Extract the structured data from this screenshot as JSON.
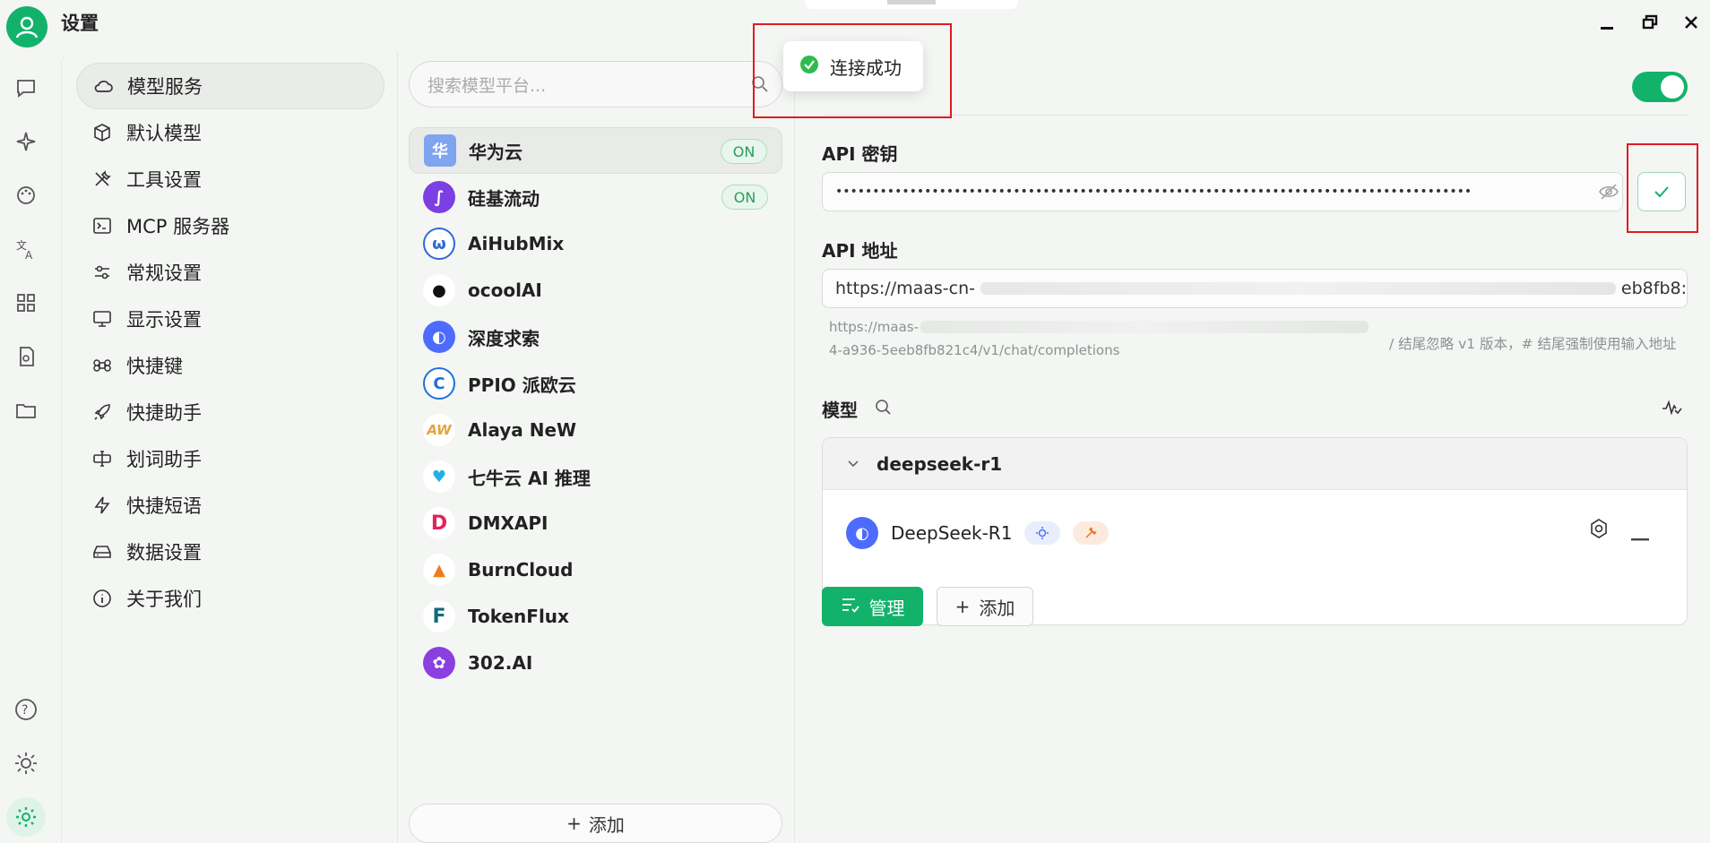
{
  "window": {
    "title": "设置"
  },
  "sidebar_nav": [
    {
      "label": "模型服务",
      "icon": "cloud-icon",
      "active": true
    },
    {
      "label": "默认模型",
      "icon": "cube-icon"
    },
    {
      "label": "工具设置",
      "icon": "tools-icon"
    },
    {
      "label": "MCP 服务器",
      "icon": "terminal-icon"
    },
    {
      "label": "常规设置",
      "icon": "sliders-icon"
    },
    {
      "label": "显示设置",
      "icon": "monitor-icon"
    },
    {
      "label": "快捷键",
      "icon": "command-icon"
    },
    {
      "label": "快捷助手",
      "icon": "rocket-icon"
    },
    {
      "label": "划词助手",
      "icon": "text-cursor-icon"
    },
    {
      "label": "快捷短语",
      "icon": "lightning-icon"
    },
    {
      "label": "数据设置",
      "icon": "drive-icon"
    },
    {
      "label": "关于我们",
      "icon": "info-icon"
    }
  ],
  "providers": {
    "search_placeholder": "搜索模型平台...",
    "items": [
      {
        "name": "华为云",
        "on": "ON",
        "active": true,
        "logo_text": "华",
        "color": "#5b8def"
      },
      {
        "name": "硅基流动",
        "on": "ON",
        "logo_text": "∫",
        "color": "#7b3fe4"
      },
      {
        "name": "AiHubMix",
        "logo_text": "ω",
        "color": "#2d6ad8"
      },
      {
        "name": "ocoolAI",
        "logo_text": "●",
        "color": "#111111"
      },
      {
        "name": "深度求索",
        "logo_text": "◐",
        "color": "#4d6bfe"
      },
      {
        "name": "PPIO 派欧云",
        "logo_text": "C",
        "color": "#1f6fe0"
      },
      {
        "name": "Alaya NeW",
        "logo_text": "AW",
        "color": "#e8a23a"
      },
      {
        "name": "七牛云 AI 推理",
        "logo_text": "♥",
        "color": "#21b0e3"
      },
      {
        "name": "DMXAPI",
        "logo_text": "D",
        "color": "#e0245e"
      },
      {
        "name": "BurnCloud",
        "logo_text": "▲",
        "color": "#f07c1e"
      },
      {
        "name": "TokenFlux",
        "logo_text": "F",
        "color": "#0e6b78"
      },
      {
        "name": "302.AI",
        "logo_text": "✿",
        "color": "#8b3fe0"
      }
    ],
    "add_label": "添加"
  },
  "detail": {
    "toggle_on": true,
    "api_key_label": "API 密钥",
    "api_key_value": "••••••••••••••••••••••••••••••••••••••••••••••••••••••••••••••••••••••••••••••••••••••",
    "api_url_label": "API 地址",
    "api_url_value": "https://maas-cn-",
    "api_url_tail": "eb8fb8:",
    "hint_line1_start": "https://maas-",
    "hint_line1_end": "/ 结尾忽略 v1 版本，# 结尾强制使用输入地址",
    "hint_line2": "4-a936-5eeb8fb821c4/v1/chat/completions",
    "models_label": "模型",
    "model_group": "deepseek-r1",
    "model_name": "DeepSeek-R1",
    "manage_label": "管理",
    "add_label": "添加"
  },
  "toast": {
    "text": "连接成功"
  },
  "colors": {
    "accent": "#12b26b",
    "highlight": "#e01b24"
  }
}
